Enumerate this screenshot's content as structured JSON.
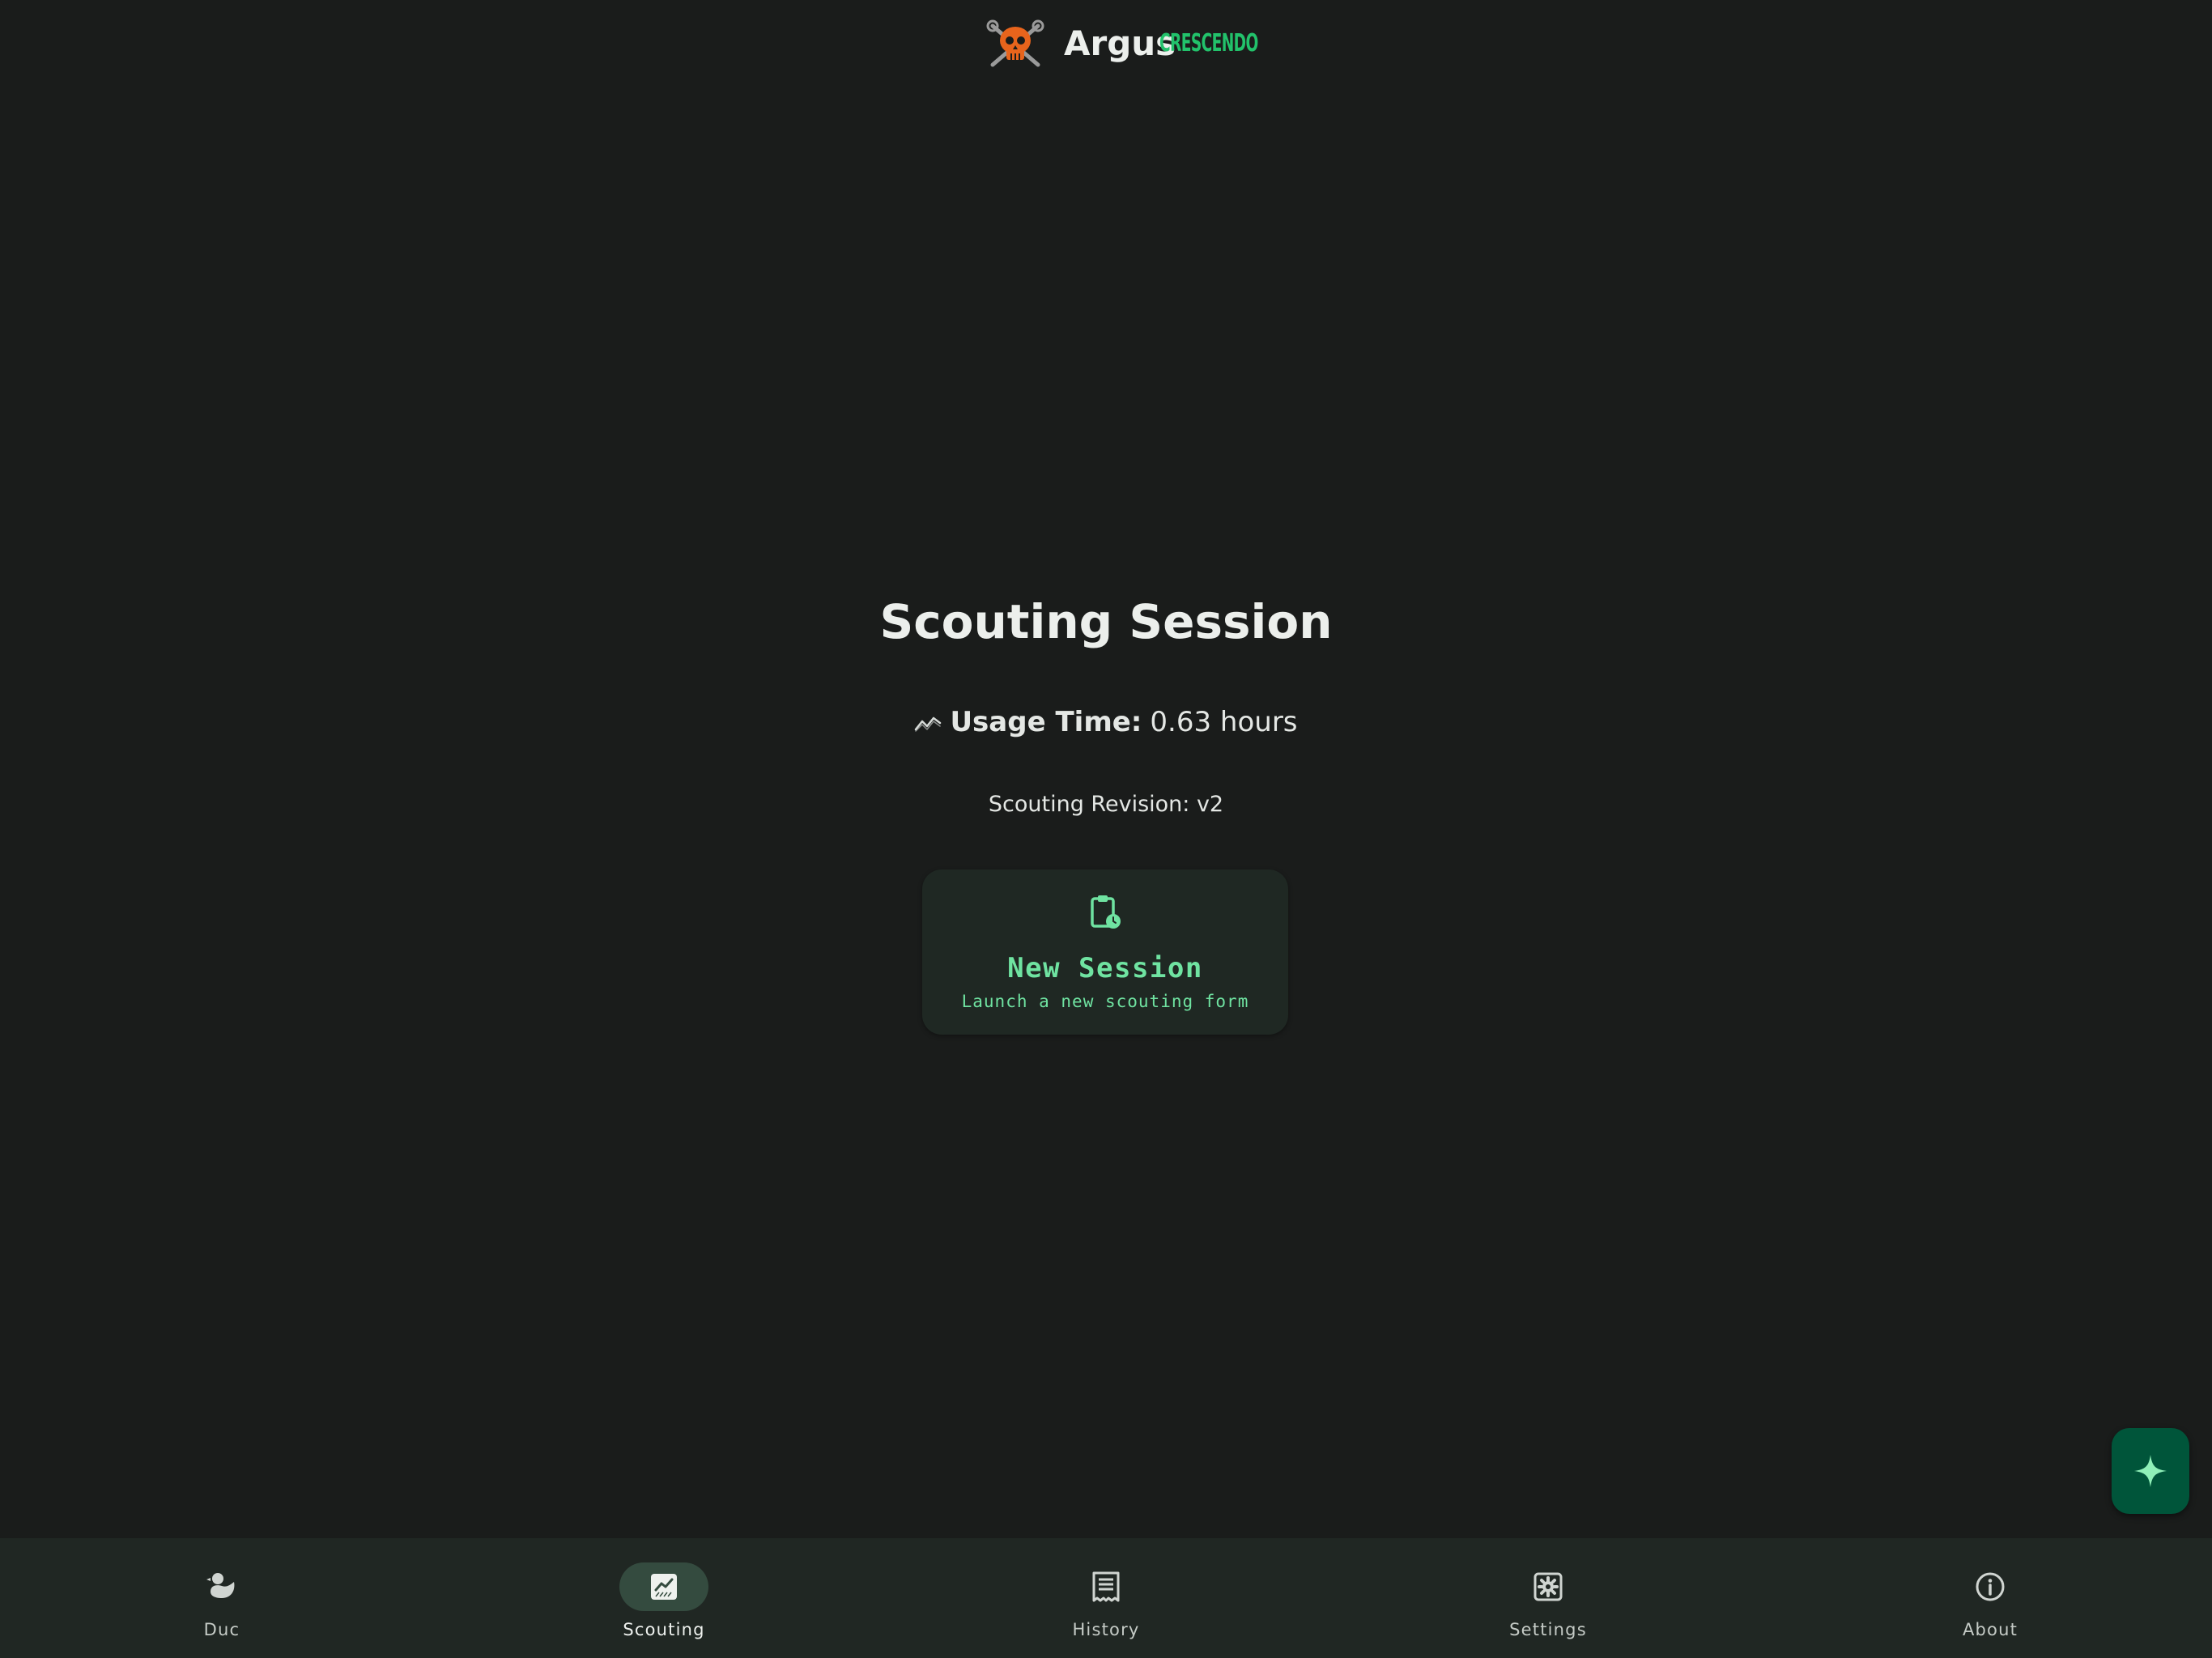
{
  "header": {
    "app_name": "Argus",
    "team_logo": "skull-wrench-logo",
    "brand_wordmark": "CRESCENDO"
  },
  "main": {
    "title": "Scouting Session",
    "usage_icon": "trend-line-icon",
    "usage_label": "Usage Time:",
    "usage_value": "0.63 hours",
    "revision_text": "Scouting Revision: v2",
    "new_session": {
      "icon": "clipboard-clock-icon",
      "title": "New Session",
      "subtitle": "Launch a new scouting form"
    }
  },
  "fab": {
    "icon": "sparkle-icon"
  },
  "bottom_nav": {
    "items": [
      {
        "label": "Duc",
        "icon": "duck-icon",
        "active": false
      },
      {
        "label": "Scouting",
        "icon": "chart-icon",
        "active": true
      },
      {
        "label": "History",
        "icon": "receipt-icon",
        "active": false
      },
      {
        "label": "Settings",
        "icon": "gear-icon",
        "active": false
      },
      {
        "label": "About",
        "icon": "info-icon",
        "active": false
      }
    ]
  },
  "colors": {
    "background": "#1a1c1b",
    "nav_background": "#202723",
    "accent": "#6fe3a1",
    "brand_green": "#22c26b",
    "fab": "#00553a",
    "logo_orange": "#e8641c"
  }
}
